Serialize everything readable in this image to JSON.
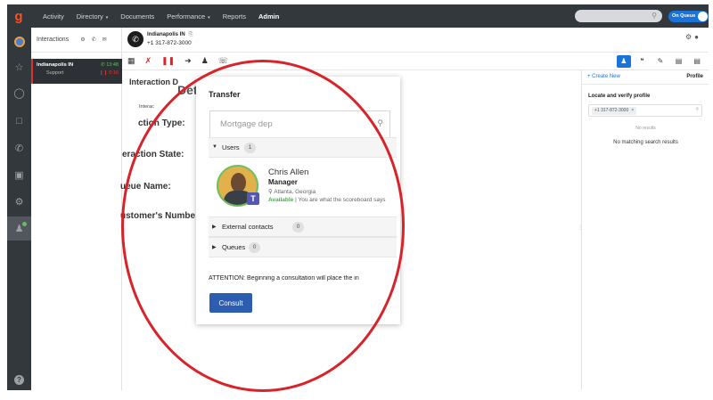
{
  "topnav": {
    "items": [
      {
        "label": "Activity",
        "caret": ""
      },
      {
        "label": "Directory",
        "caret": "▾"
      },
      {
        "label": "Documents",
        "caret": ""
      },
      {
        "label": "Performance",
        "caret": "▾"
      },
      {
        "label": "Reports",
        "caret": ""
      },
      {
        "label": "Admin",
        "caret": ""
      }
    ],
    "queue_label": "On Queue"
  },
  "interactions": {
    "title": "Interactions",
    "card": {
      "name": "Indianapolis IN",
      "sub": "Support",
      "time1": "✆ 13:48",
      "time2": "❙❙ 0:16"
    }
  },
  "call": {
    "name": "Indianapolis IN",
    "copy_icon": "⎘",
    "number": "+1 317-872-3000"
  },
  "main": {
    "details_title": "Interaction D",
    "details_big": "Deta",
    "inter_small": "Interac",
    "fields": [
      "ction Type:",
      "eraction State:",
      "ueue Name:",
      "ustomer's Numbe"
    ]
  },
  "right_panel": {
    "create_new": "+ Create New",
    "profile": "Profile",
    "locate": "Locate and verify profile",
    "chip": "+1 317-872-3000",
    "chip_x": "×",
    "no_results": "No results",
    "no_match": "No matching search results"
  },
  "transfer": {
    "title": "Transfer",
    "search_value": "",
    "search_placeholder": "Mortgage dep",
    "sections": {
      "users": {
        "label": "Users",
        "count": "1"
      },
      "external": {
        "label": "External contacts",
        "count": "0"
      },
      "queues": {
        "label": "Queues",
        "count": "0"
      }
    },
    "user": {
      "name": "Chris Allen",
      "role": "Manager",
      "location": "Atlanta, Georgia",
      "status": "Available",
      "status_sep": " | ",
      "status_msg": "You are what the scoreboard says",
      "badge": "T"
    },
    "attention": "ATTENTION: Beginning a consultation will place the in",
    "consult": "Consult"
  },
  "colors": {
    "nav_bg": "#33383d",
    "accent_blue": "#1a73d9",
    "consult_blue": "#2c5db0",
    "annotation_red": "#d8232a",
    "available_green": "#4caf50"
  }
}
